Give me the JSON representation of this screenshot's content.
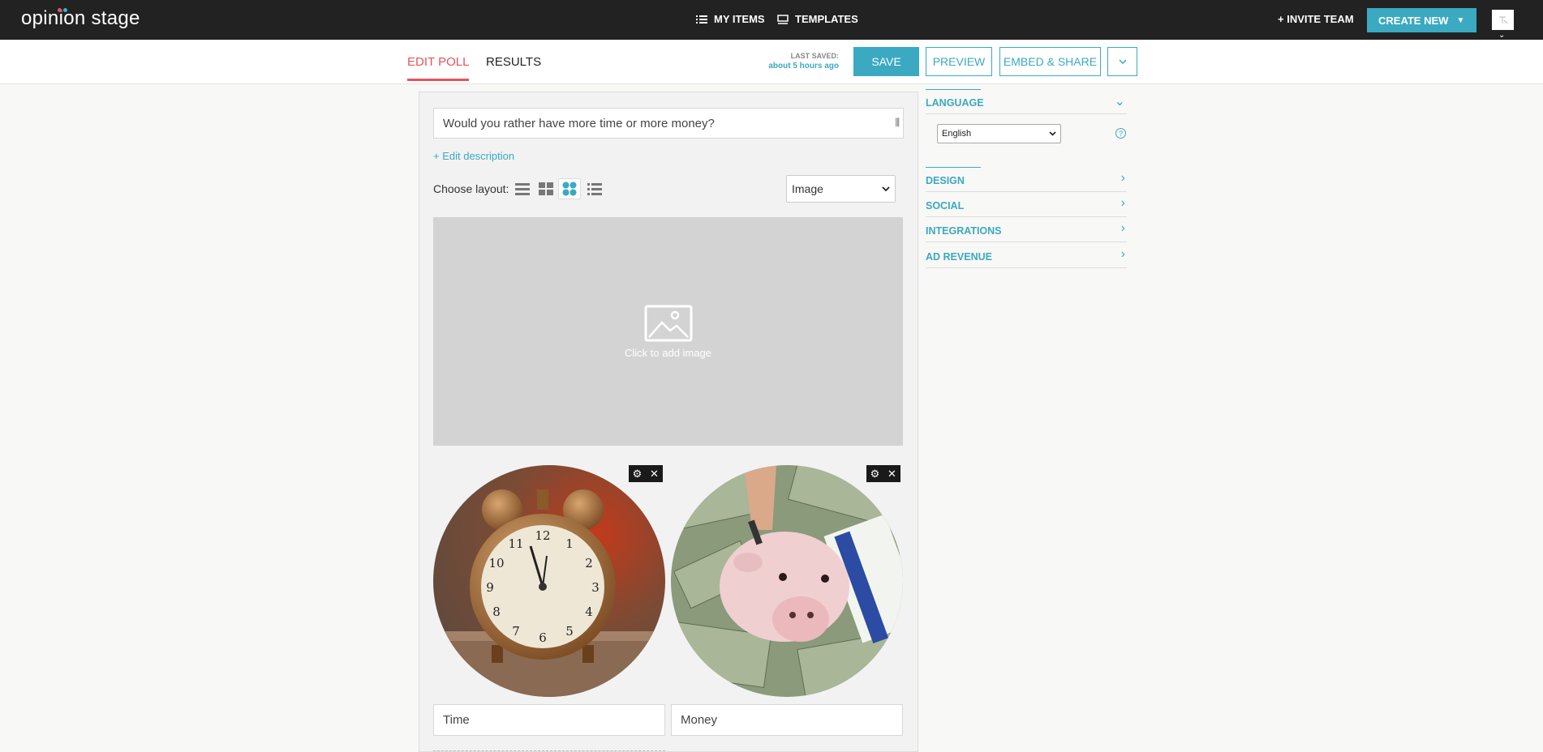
{
  "header": {
    "logo": "opinion stage",
    "my_items": "MY ITEMS",
    "templates": "TEMPLATES",
    "invite": "+ INVITE TEAM",
    "create_new": "CREATE NEW"
  },
  "subbar": {
    "tabs": [
      "EDIT POLL",
      "RESULTS"
    ],
    "last_saved_label": "LAST SAVED:",
    "last_saved_value": "about 5 hours ago",
    "save": "SAVE",
    "preview": "PREVIEW",
    "embed_share": "EMBED & SHARE"
  },
  "editor": {
    "question": "Would you rather have more time or more money?",
    "edit_description": "+ Edit description",
    "choose_layout": "Choose layout:",
    "media_type": "Image",
    "add_image": "Click to add image",
    "answers": [
      {
        "label": "Time",
        "icon": "alarm-clock-photo"
      },
      {
        "label": "Money",
        "icon": "piggy-bank-photo"
      }
    ]
  },
  "sidebar": {
    "language_title": "LANGUAGE",
    "language_value": "English",
    "sections": [
      "DESIGN",
      "SOCIAL",
      "INTEGRATIONS",
      "AD REVENUE"
    ]
  },
  "colors": {
    "accent": "#3ba9c1",
    "active_tab": "#e8535b",
    "topbar": "#222222"
  }
}
